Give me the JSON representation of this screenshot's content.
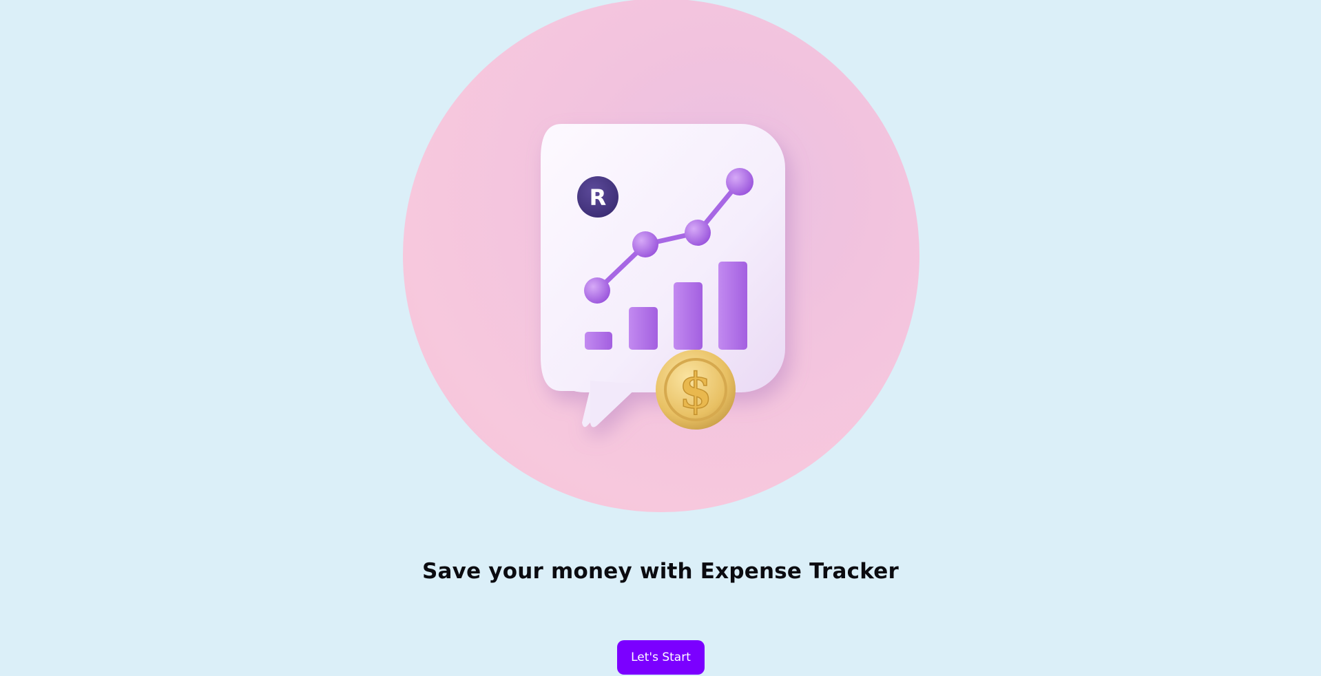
{
  "hero": {
    "illustration": "chart-growth-coin-icon",
    "badge_letter": "R",
    "coin_symbol": "$"
  },
  "headline": "Save your money with Expense Tracker",
  "cta": {
    "label": "Let's Start"
  },
  "colors": {
    "background": "#dbeff8",
    "hero_circle": "#f5c4dc",
    "accent": "#7b00ff",
    "chart": "#b06ee8",
    "badge": "#4b3a86",
    "coin": "#e6bd5a"
  }
}
